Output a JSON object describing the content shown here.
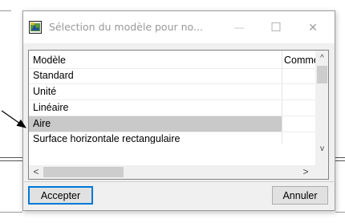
{
  "window": {
    "title": "Sélection du modèle pour no...",
    "minimize_glyph": "—",
    "maximize_glyph": "☐",
    "close_glyph": "✕"
  },
  "table": {
    "columns": [
      "Modèle",
      "Commer"
    ],
    "rows": [
      {
        "model": "Standard",
        "comment": ""
      },
      {
        "model": "Unité",
        "comment": ""
      },
      {
        "model": "Linéaire",
        "comment": ""
      },
      {
        "model": "Aire",
        "comment": "",
        "selected": true
      },
      {
        "model": "Surface horizontale rectangulaire",
        "comment": ""
      }
    ]
  },
  "scrollbars": {
    "up": "^",
    "down": "v",
    "left": "<",
    "right": ">"
  },
  "buttons": {
    "accept": "Accepter",
    "cancel": "Annuler"
  },
  "icons": {
    "app": "dialog-app-icon",
    "pointer": "annotation-arrow"
  }
}
